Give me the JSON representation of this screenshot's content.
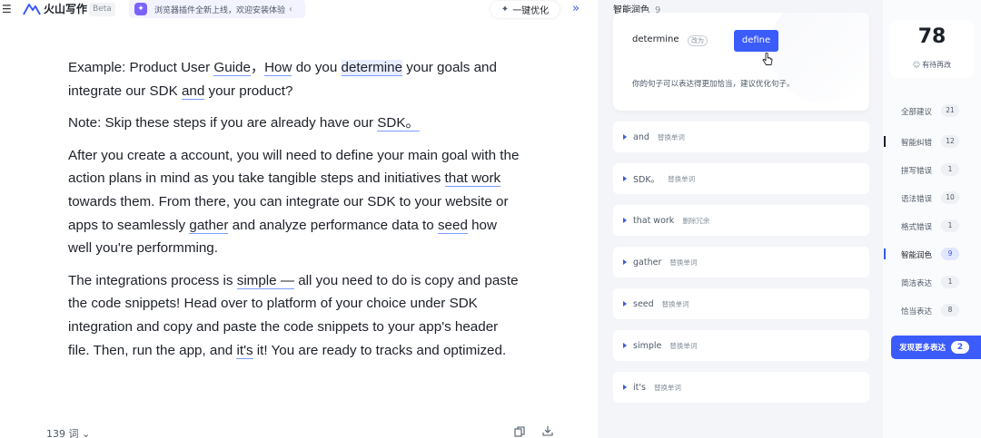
{
  "topbar": {
    "app_name": "火山写作",
    "beta": "Beta",
    "promo_text": "浏览器插件全新上线，欢迎安装体验",
    "optimize_label": "一键优化"
  },
  "editor": {
    "p1": [
      "Example: Product User ",
      "Guide",
      "，",
      "How",
      " do you ",
      "determine",
      " your goals and integrate our SDK ",
      "and",
      " your ",
      "product?"
    ],
    "p2": [
      "Note: Skip these steps if you  are already have our ",
      "SDK。"
    ],
    "p3": [
      "After you create a account, you will need to define your main goal with the action plans in mind as you take tangible steps and initiatives ",
      "that work",
      " towards them. From there, you can integrate our SDK to your website or apps to seamlessly ",
      "gather",
      " and analyze performance data to ",
      "seed",
      " how well you're performming."
    ],
    "p4": [
      "The integrations process is ",
      "simple —",
      " all you need to do is copy and paste the code snippets! Head over to platform of your choice under SDK integration and copy and paste the code snippets to your app's header file. Then, run the app, and ",
      "it's",
      " it! You are ready to tracks and optimized."
    ],
    "word_count": "139 词"
  },
  "panel": {
    "title": "智能润色",
    "count": "9",
    "active": {
      "original": "determine",
      "to_label": "改为",
      "replacement": "define",
      "description": "你的句子可以表达得更加恰当，建议优化句子。"
    },
    "suggestions": [
      {
        "word": "and",
        "tag": "替换单词"
      },
      {
        "word": "SDK。",
        "tag": "替换单词"
      },
      {
        "word": "that work",
        "tag": "删除冗余"
      },
      {
        "word": "gather",
        "tag": "替换单词"
      },
      {
        "word": "seed",
        "tag": "替换单词"
      },
      {
        "word": "simple",
        "tag": "替换单词"
      },
      {
        "word": "it's",
        "tag": "替换单词"
      }
    ]
  },
  "sidebar": {
    "score": "78",
    "score_label": "有待再改",
    "categories": [
      {
        "label": "全部建议",
        "count": "21"
      },
      {
        "label": "智能纠错",
        "count": "12"
      },
      {
        "label": "拼写错误",
        "count": "1"
      },
      {
        "label": "语法错误",
        "count": "10"
      },
      {
        "label": "格式错误",
        "count": "1"
      },
      {
        "label": "智能润色",
        "count": "9"
      },
      {
        "label": "简洁表达",
        "count": "1"
      },
      {
        "label": "恰当表达",
        "count": "8"
      }
    ],
    "more_label": "发现更多表达",
    "more_count": "2"
  },
  "colors": {
    "accent": "#3b5bfb",
    "underline": "#7b9cff"
  }
}
